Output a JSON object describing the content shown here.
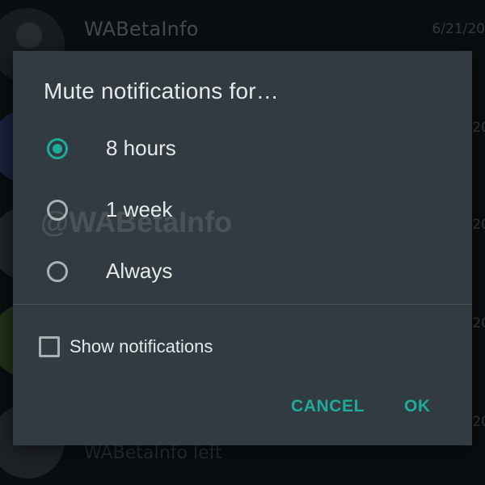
{
  "background_chats": {
    "top_name": "WABetaInfo",
    "top_date": "6/21/20",
    "bottom_text": "WABetaInfo left",
    "edge_dates": [
      "20",
      "20",
      "20",
      "20",
      "20"
    ]
  },
  "dialog": {
    "title": "Mute notifications for…",
    "options": [
      {
        "label": "8 hours",
        "checked": true
      },
      {
        "label": "1 week",
        "checked": false
      },
      {
        "label": "Always",
        "checked": false
      }
    ],
    "show_notifications_label": "Show notifications",
    "show_notifications_checked": false,
    "cancel_label": "CANCEL",
    "ok_label": "OK"
  },
  "watermark": "@WABetaInfo",
  "colors": {
    "accent": "#1dab9c",
    "dialog_bg": "#323b41",
    "text": "#e6e9ea"
  }
}
